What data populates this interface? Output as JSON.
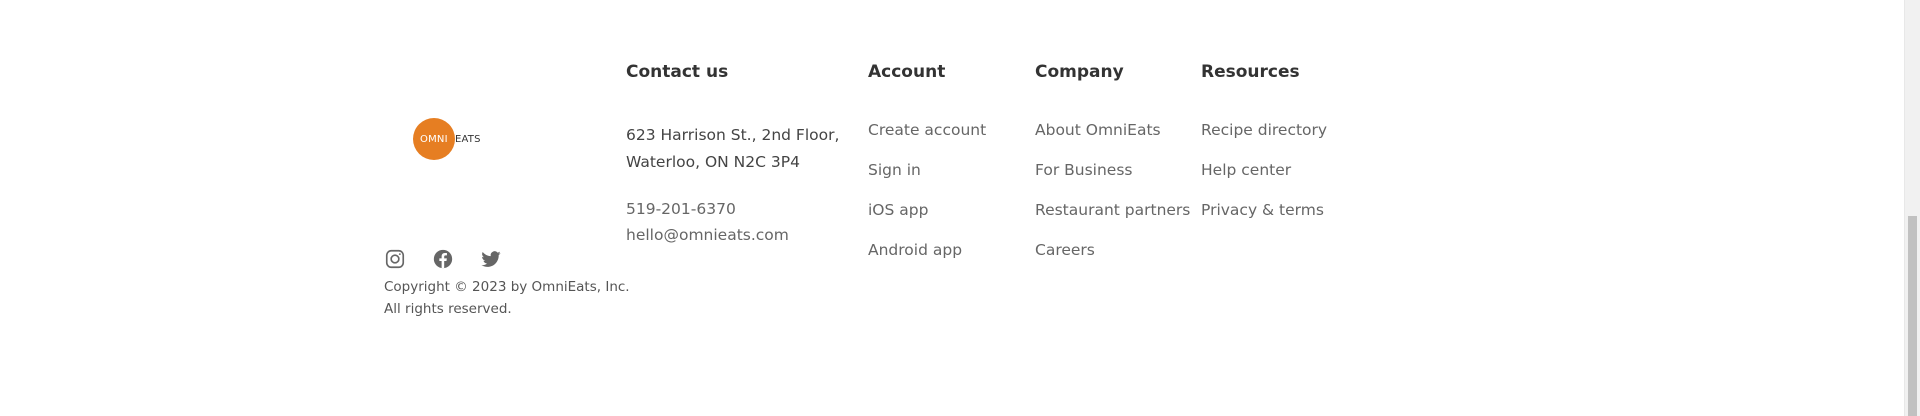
{
  "logo": {
    "circle_text": "OMNI",
    "rest_text": "EATS",
    "brand_color": "#e67e22"
  },
  "social": {
    "icons": [
      "instagram-icon",
      "facebook-icon",
      "twitter-icon"
    ]
  },
  "copyright": {
    "line1": "Copyright © 2023 by OmniEats, Inc.",
    "line2": "All rights reserved."
  },
  "contact": {
    "heading": "Contact us",
    "address_line1": "623 Harrison St., 2nd Floor,",
    "address_line2": "Waterloo, ON N2C 3P4",
    "phone": "519-201-6370",
    "email": "hello@omnieats.com"
  },
  "account": {
    "heading": "Account",
    "links": [
      "Create account",
      "Sign in",
      "iOS app",
      "Android app"
    ]
  },
  "company": {
    "heading": "Company",
    "links": [
      "About OmniEats",
      "For Business",
      "Restaurant partners",
      "Careers"
    ]
  },
  "resources": {
    "heading": "Resources",
    "links": [
      "Recipe directory",
      "Help center",
      "Privacy & terms"
    ]
  }
}
